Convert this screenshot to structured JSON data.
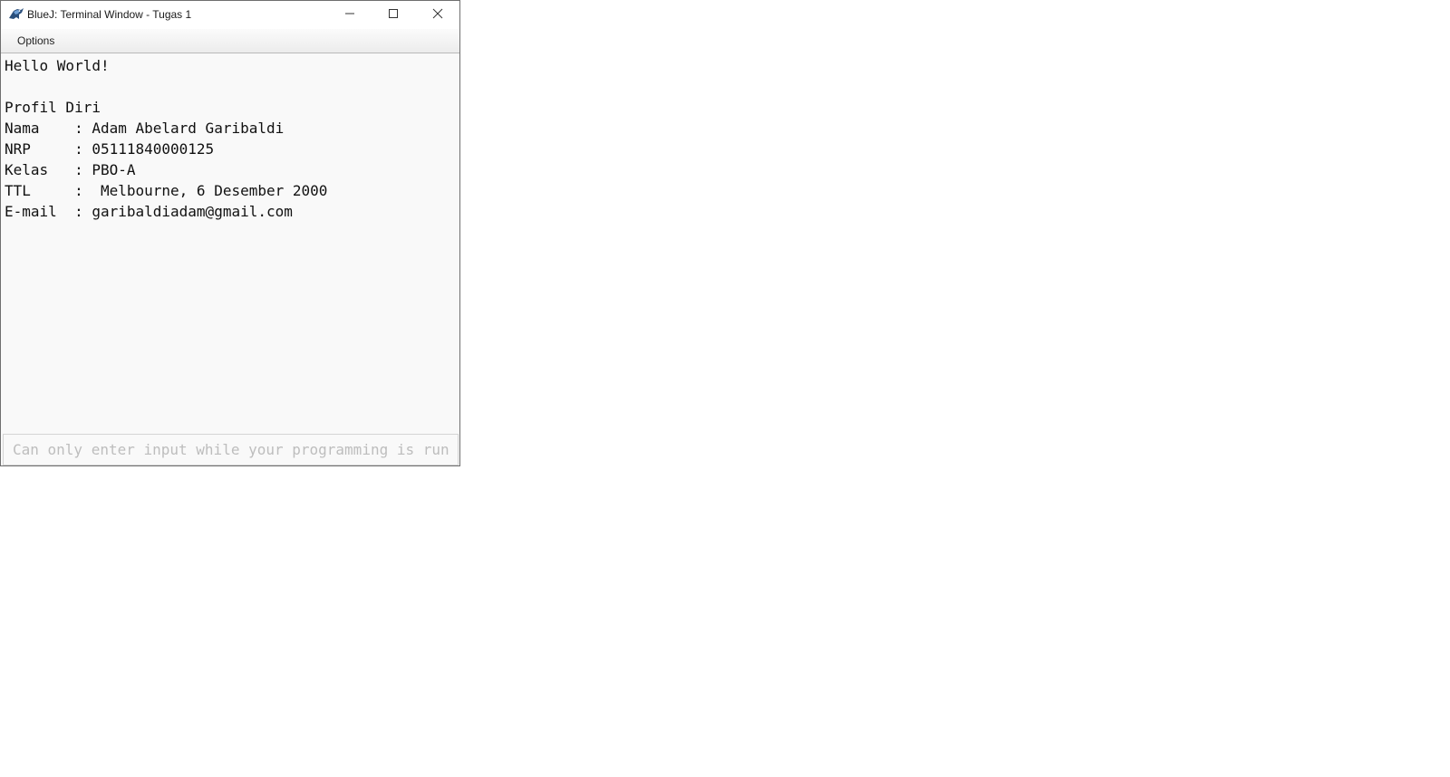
{
  "window": {
    "title": "BlueJ: Terminal Window - Tugas 1",
    "icon": "bluej-bird-icon"
  },
  "controls": {
    "minimize_icon": "minimize-icon",
    "maximize_icon": "maximize-icon",
    "close_icon": "close-icon"
  },
  "menu": {
    "options_label": "Options"
  },
  "terminal": {
    "lines": [
      "Hello World!",
      "",
      "Profil Diri",
      "Nama    : Adam Abelard Garibaldi",
      "NRP     : 05111840000125",
      "Kelas   : PBO-A",
      "TTL     :  Melbourne, 6 Desember 2000",
      "E-mail  : garibaldiadam@gmail.com"
    ]
  },
  "input": {
    "placeholder": "Can only enter input while your programming is running",
    "value": ""
  }
}
